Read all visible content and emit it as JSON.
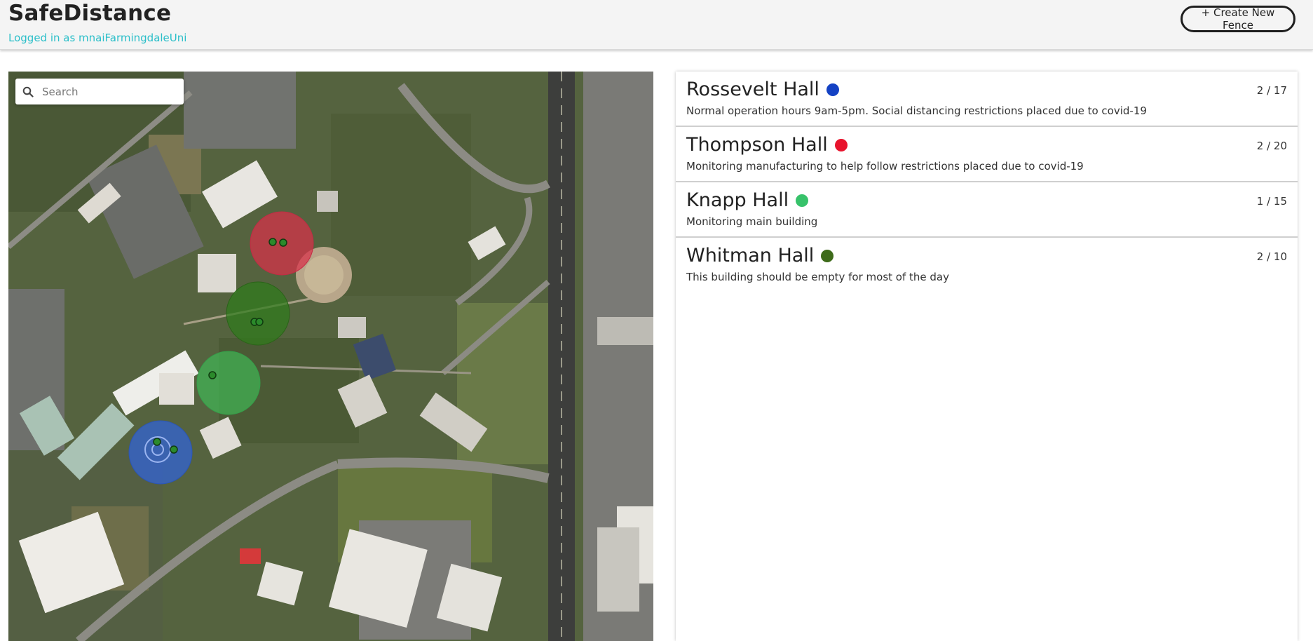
{
  "app": {
    "title": "SafeDistance",
    "login_text": "Logged in as mnaiFarmingdaleUni",
    "create_button": "+ Create New Fence"
  },
  "search": {
    "placeholder": "Search",
    "icon": "search-icon"
  },
  "fences": [
    {
      "name": "Rossevelt Hall",
      "color": "#1442c4",
      "count": "2 / 17",
      "description": "Normal operation hours 9am-5pm. Social distancing restrictions placed due to covid-19"
    },
    {
      "name": "Thompson Hall",
      "color": "#e8142d",
      "count": "2 / 20",
      "description": "Monitoring manufacturing to help follow restrictions placed due to covid-19"
    },
    {
      "name": "Knapp Hall",
      "color": "#37c26a",
      "count": "1 / 15",
      "description": "Monitoring main building"
    },
    {
      "name": "Whitman Hall",
      "color": "#3e6b1a",
      "count": "2 / 10",
      "description": "This building should be empty for most of the day"
    }
  ]
}
